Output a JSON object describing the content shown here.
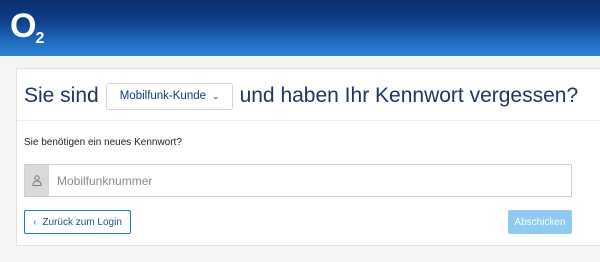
{
  "header": {
    "logo_main": "O",
    "logo_sub": "2"
  },
  "headline": {
    "prefix": "Sie sind",
    "dropdown_value": "Mobilfunk-Kunde",
    "suffix": "und haben Ihr Kennwort vergessen?"
  },
  "form": {
    "subtext": "Sie benötigen ein neues Kennwort?",
    "phone_placeholder": "Mobilfunknummer",
    "back_label": "Zurück zum Login",
    "submit_label": "Abschicken"
  },
  "colors": {
    "header_dark": "#0a2d6e",
    "header_light": "#2f86d6",
    "headline_text": "#1f3562",
    "link_blue": "#1f78c8",
    "submit_bg": "#8fcaf0"
  }
}
